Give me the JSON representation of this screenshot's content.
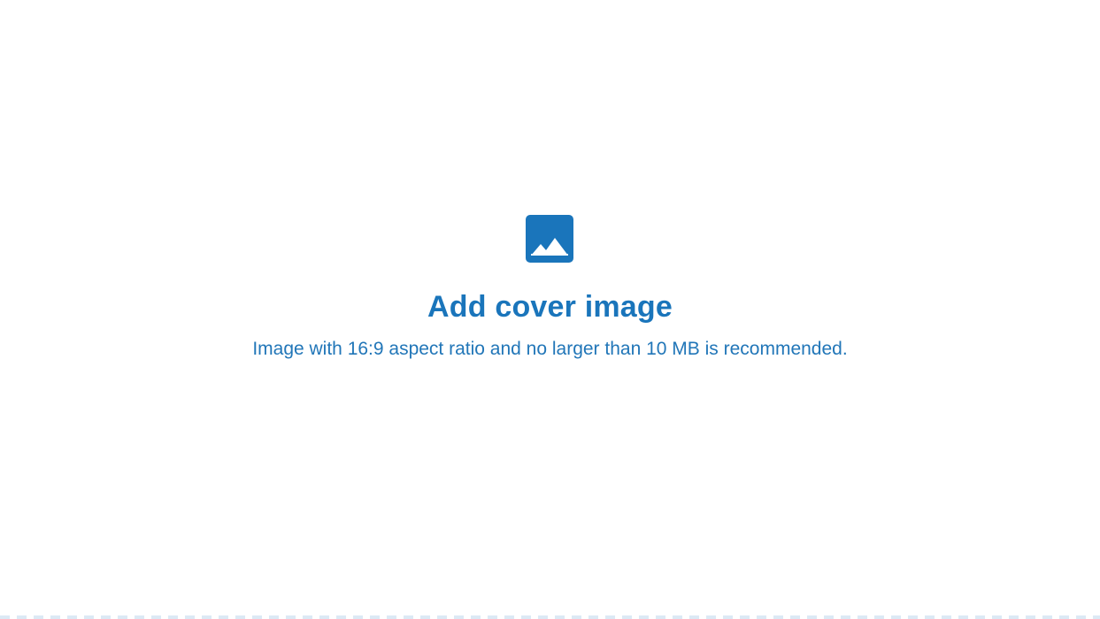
{
  "cover_upload": {
    "icon": "image-icon",
    "title": "Add cover image",
    "hint": "Image with 16:9 aspect ratio and no larger than 10 MB is recommended."
  },
  "colors": {
    "accent": "#1a75bb",
    "text": "#2176b8",
    "border": "#dce9f5",
    "background": "#ffffff"
  }
}
